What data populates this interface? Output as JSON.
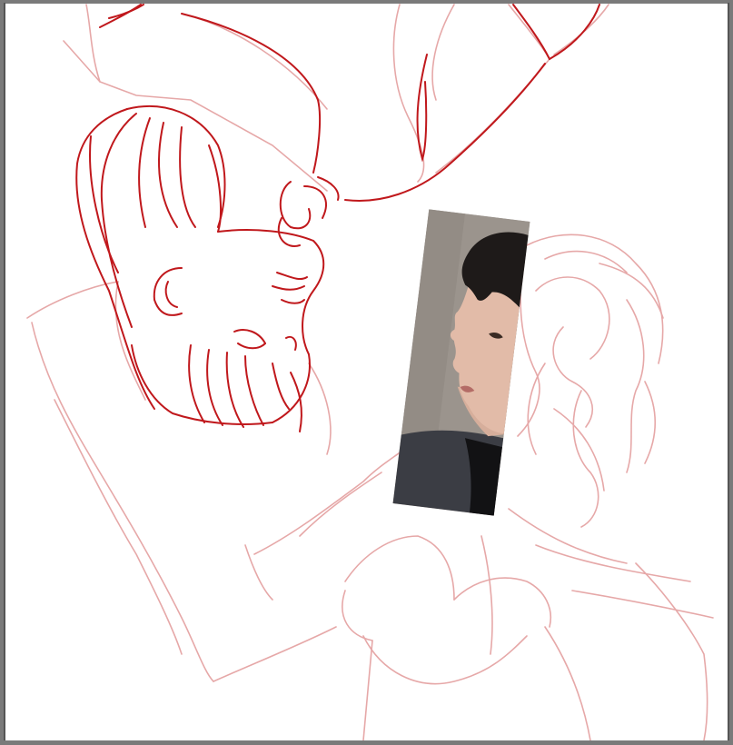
{
  "canvas": {
    "background": "#ffffff",
    "border_color": "#7a7a7a",
    "ink_dark": "#c0181c",
    "ink_light": "#e6a8a8"
  },
  "reference_photo": {
    "description_icon": "portrait-photo-icon",
    "colors": {
      "backdrop": "#9b948d",
      "hair": "#1e1a19",
      "skin": "#e2bba8",
      "jacket": "#3b3d44",
      "shirt": "#121214"
    }
  }
}
